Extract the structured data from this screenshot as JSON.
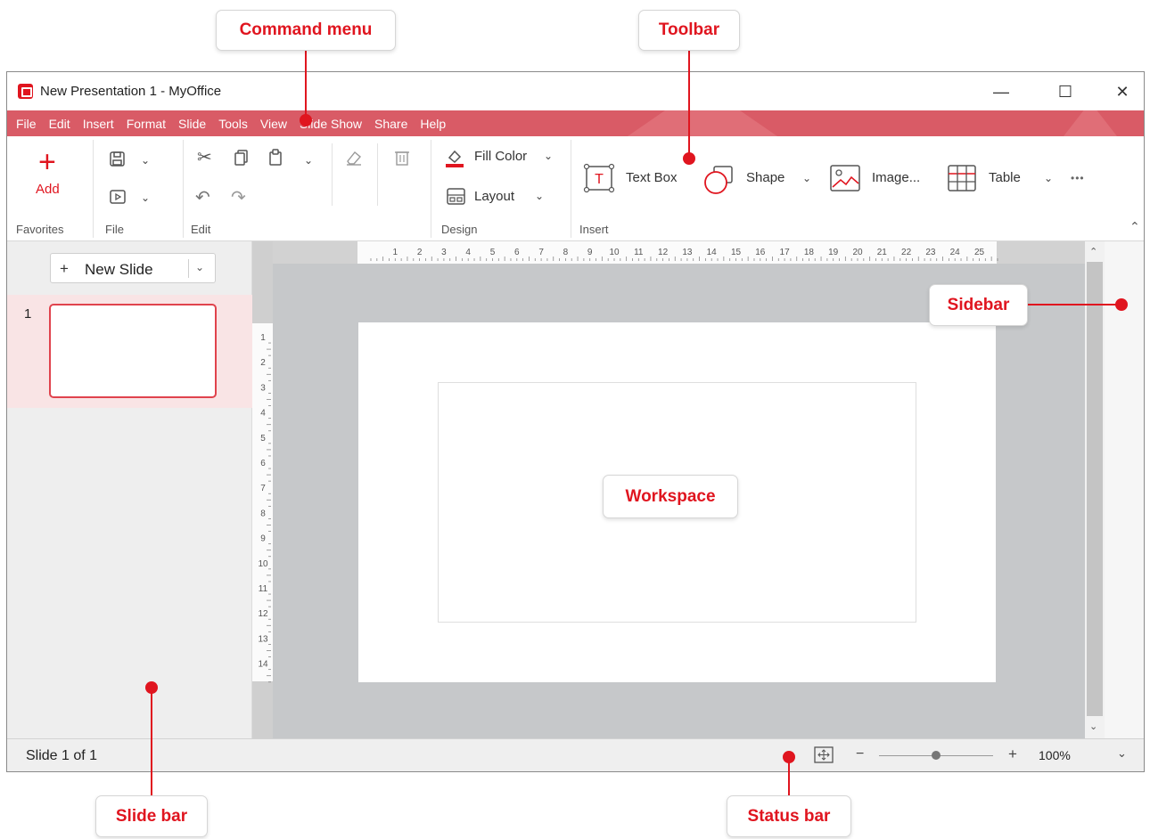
{
  "annotations": {
    "command_menu": "Command menu",
    "toolbar": "Toolbar",
    "sidebar": "Sidebar",
    "workspace": "Workspace",
    "slide_bar": "Slide bar",
    "status_bar": "Status bar"
  },
  "window": {
    "title": "New Presentation 1 - MyOffice",
    "minimize": "—",
    "maximize": "☐",
    "close": "✕"
  },
  "menu": [
    "File",
    "Edit",
    "Insert",
    "Format",
    "Slide",
    "Tools",
    "View",
    "Slide Show",
    "Share",
    "Help"
  ],
  "ribbon": {
    "add_label": "Add",
    "groups": {
      "favorites": "Favorites",
      "file": "File",
      "edit": "Edit",
      "design": "Design",
      "insert": "Insert"
    },
    "fill_color": "Fill Color",
    "layout": "Layout",
    "text_box": "Text Box",
    "shape": "Shape",
    "image": "Image...",
    "table": "Table",
    "more": "•••"
  },
  "slidebar": {
    "new_slide_plus": "+",
    "new_slide_label": "New Slide",
    "slides": [
      {
        "number": "1"
      }
    ]
  },
  "rulers": {
    "horizontal": [
      "1",
      "2",
      "3",
      "4",
      "5",
      "6",
      "7",
      "8",
      "9",
      "10",
      "11",
      "12",
      "13",
      "14",
      "15",
      "16",
      "17",
      "18",
      "19",
      "20",
      "21",
      "22",
      "23",
      "24",
      "25"
    ],
    "vertical": [
      "1",
      "2",
      "3",
      "4",
      "5",
      "6",
      "7",
      "8",
      "9",
      "10",
      "11",
      "12",
      "13",
      "14"
    ]
  },
  "statusbar": {
    "slide_count": "Slide 1 of 1",
    "zoom_minus": "−",
    "zoom_plus": "+",
    "zoom_level": "100%"
  },
  "colors": {
    "accent": "#e0151f",
    "menubar": "#d95b66",
    "selection": "#f9e4e5"
  }
}
